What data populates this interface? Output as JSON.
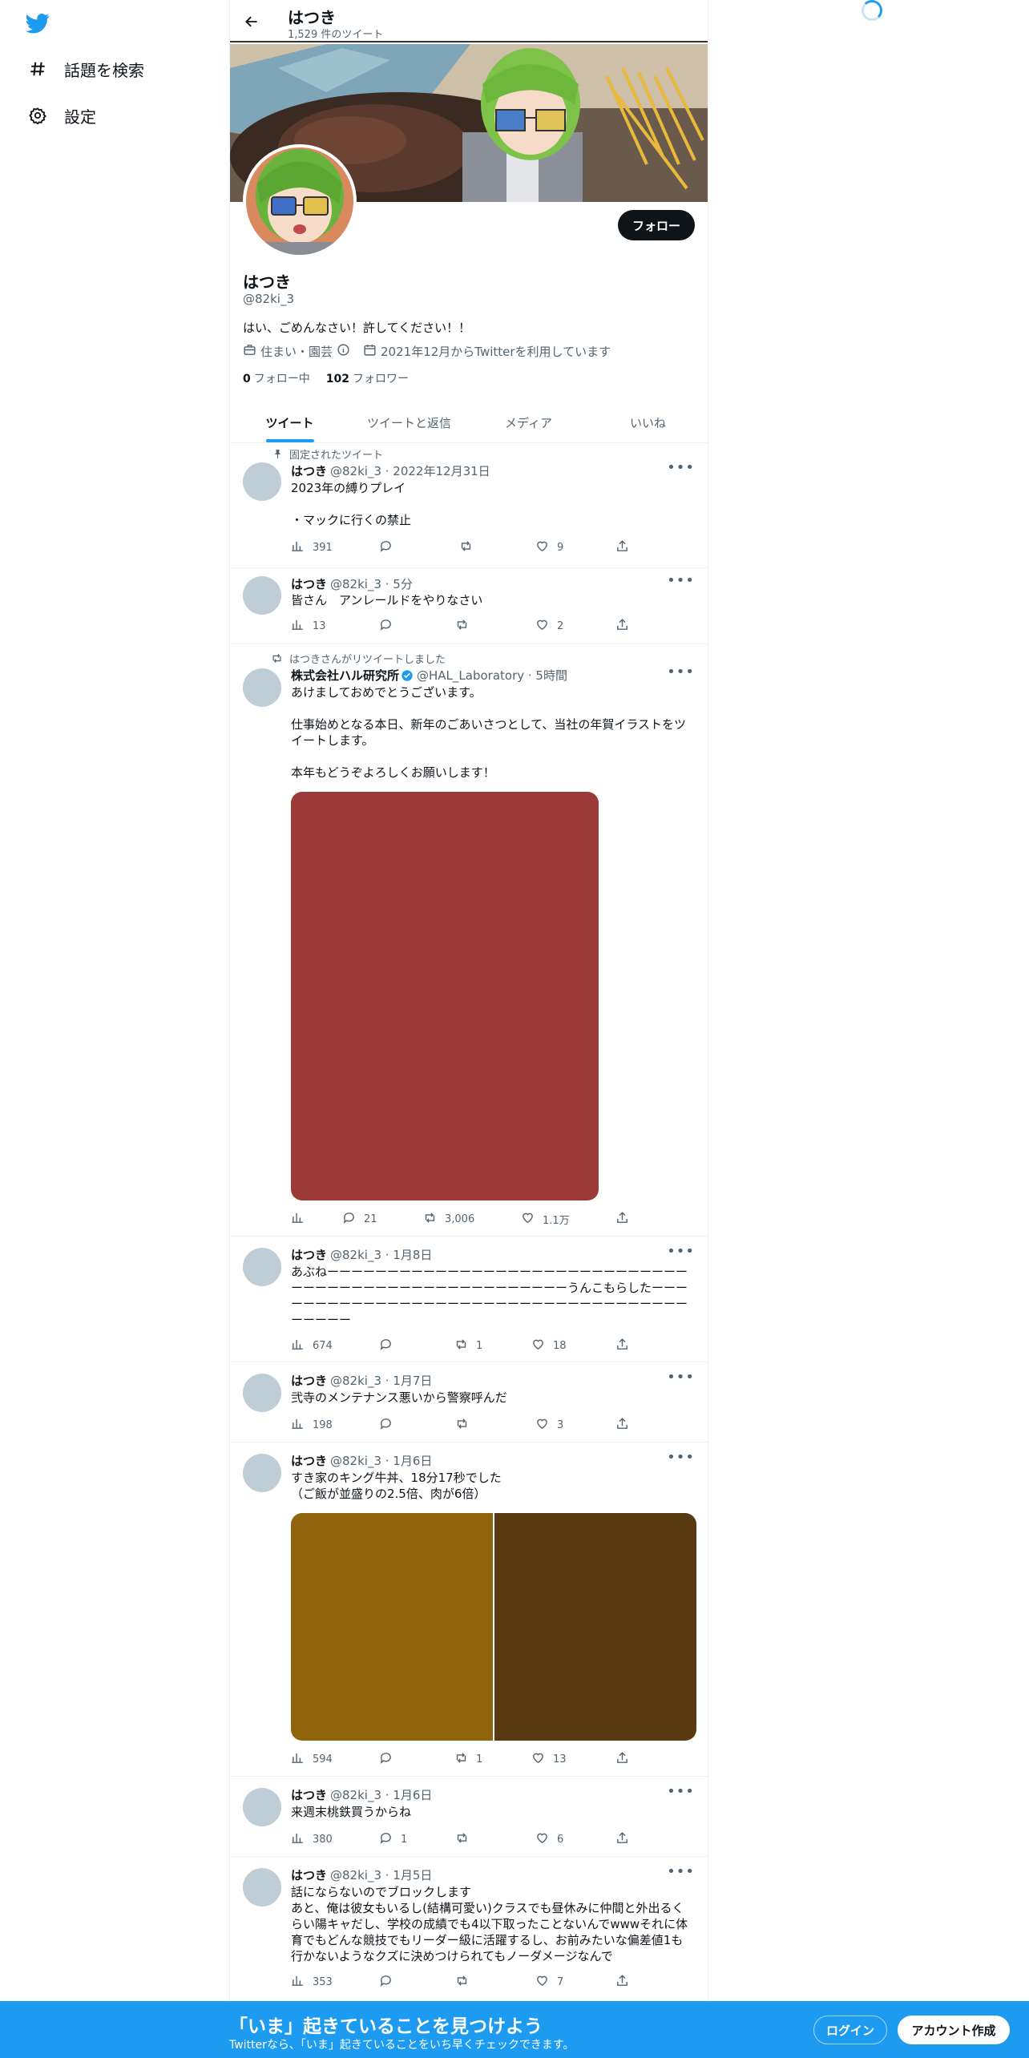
{
  "nav": {
    "explore_label": "話題を検索",
    "settings_label": "設定"
  },
  "header": {
    "name": "はつき",
    "tweet_count": "1,529 件のツイート"
  },
  "profile": {
    "follow_button": "フォロー",
    "name": "はつき",
    "handle": "@82ki_3",
    "bio": "はい、ごめんなさい！許してください！！",
    "location": "住まい・園芸",
    "joined": "2021年12月からTwitterを利用しています",
    "following_count": "0",
    "following_label": "フォロー中",
    "followers_count": "102",
    "followers_label": "フォロワー"
  },
  "tabs": [
    {
      "label": "ツイート"
    },
    {
      "label": "ツイートと返信"
    },
    {
      "label": "メディア"
    },
    {
      "label": "いいね"
    }
  ],
  "tweets": [
    {
      "social": "固定されたツイート",
      "name": "はつき",
      "meta": "@82ki_3 · 2022年12月31日",
      "text": "2023年の縛りプレイ\n\n・マックに行くの禁止",
      "views": "391",
      "replies": "",
      "retweets": "",
      "likes": "9"
    },
    {
      "name": "はつき",
      "meta": "@82ki_3 · 5分",
      "text": "皆さん　アンレールドをやりなさい",
      "views": "13",
      "replies": "",
      "retweets": "",
      "likes": "2"
    },
    {
      "social": "はつきさんがリツイートしました",
      "name": "株式会社ハル研究所",
      "meta": "@HAL_Laboratory · 5時間",
      "text": "あけましておめでとうございます。\n\n仕事始めとなる本日、新年のごあいさつとして、当社の年賀イラストをツイートします。\n\n本年もどうぞよろしくお願いします！",
      "views": "",
      "replies": "21",
      "retweets": "3,006",
      "likes": "1.1万",
      "media_color": "#9b3a38"
    },
    {
      "name": "はつき",
      "meta": "@82ki_3 · 1月8日",
      "text": "あぶねーーーーーーーーーーーーーーーーーーーーーーーーーーーーーーーーーーーーーーーーーーーーーーーーーーーーーうんこもらしたーーーーーーーーーーーーーーーーーーーーーーーーーーーーーーーーーーーーーーーーー",
      "views": "674",
      "replies": "",
      "retweets": "1",
      "likes": "18"
    },
    {
      "name": "はつき",
      "meta": "@82ki_3 · 1月7日",
      "text": "弐寺のメンテナンス悪いから警察呼んだ",
      "views": "198",
      "replies": "",
      "retweets": "",
      "likes": "3"
    },
    {
      "name": "はつき",
      "meta": "@82ki_3 · 1月6日",
      "text": "すき家のキング牛丼、18分17秒でした\n（ご飯が並盛りの2.5倍、肉が6倍）",
      "views": "594",
      "replies": "",
      "retweets": "1",
      "likes": "13",
      "media_colors": [
        "#8f640c",
        "#5a3a10"
      ]
    },
    {
      "name": "はつき",
      "meta": "@82ki_3 · 1月6日",
      "text": "来週末桃鉄買うからね",
      "views": "380",
      "replies": "1",
      "retweets": "",
      "likes": "6"
    },
    {
      "name": "はつき",
      "meta": "@82ki_3 · 1月5日",
      "text": "話にならないのでブロックします\nあと、俺は彼女もいるし(結構可愛い)クラスでも昼休みに仲間と外出るくらい陽キャだし、学校の成績でも4以下取ったことないんでwwwそれに体育でもどんな競技でもリーダー級に活躍するし、お前みたいな偏差値1も行かないようなクズに決めつけられてもノーダメージなんで",
      "views": "353",
      "replies": "",
      "retweets": "",
      "likes": "7"
    }
  ],
  "bottom": {
    "title": "「いま」起きていることを見つけよう",
    "subtitle": "Twitterなら、「いま」起きていることをいち早くチェックできます。",
    "login": "ログイン",
    "signup": "アカウント作成"
  },
  "colors": {
    "accent": "#1d9bf0",
    "text": "#0f1419",
    "muted": "#536471"
  }
}
